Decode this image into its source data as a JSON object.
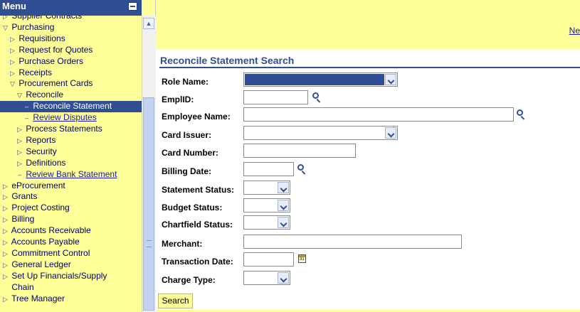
{
  "sidebar": {
    "title": "Menu",
    "items": [
      {
        "label": "Supplier Contracts",
        "indent": 0,
        "glyph": "▷",
        "state": "normal"
      },
      {
        "label": "Purchasing",
        "indent": 0,
        "glyph": "▽",
        "state": "normal"
      },
      {
        "label": "Requisitions",
        "indent": 1,
        "glyph": "▷",
        "state": "normal"
      },
      {
        "label": "Request for Quotes",
        "indent": 1,
        "glyph": "▷",
        "state": "normal"
      },
      {
        "label": "Purchase Orders",
        "indent": 1,
        "glyph": "▷",
        "state": "normal"
      },
      {
        "label": "Receipts",
        "indent": 1,
        "glyph": "▷",
        "state": "normal"
      },
      {
        "label": "Procurement Cards",
        "indent": 1,
        "glyph": "▽",
        "state": "normal"
      },
      {
        "label": "Reconcile",
        "indent": 2,
        "glyph": "▽",
        "state": "normal"
      },
      {
        "label": "Reconcile Statement",
        "indent": 3,
        "glyph": "–",
        "state": "selected"
      },
      {
        "label": "Review Disputes",
        "indent": 3,
        "glyph": "–",
        "state": "link"
      },
      {
        "label": "Process Statements",
        "indent": 2,
        "glyph": "▷",
        "state": "normal"
      },
      {
        "label": "Reports",
        "indent": 2,
        "glyph": "▷",
        "state": "normal"
      },
      {
        "label": "Security",
        "indent": 2,
        "glyph": "▷",
        "state": "normal"
      },
      {
        "label": "Definitions",
        "indent": 2,
        "glyph": "▷",
        "state": "normal"
      },
      {
        "label": "Review Bank Statement",
        "indent": 2,
        "glyph": "–",
        "state": "link"
      },
      {
        "label": "eProcurement",
        "indent": 0,
        "glyph": "▷",
        "state": "normal"
      },
      {
        "label": "Grants",
        "indent": 0,
        "glyph": "▷",
        "state": "normal"
      },
      {
        "label": "Project Costing",
        "indent": 0,
        "glyph": "▷",
        "state": "normal"
      },
      {
        "label": "Billing",
        "indent": 0,
        "glyph": "▷",
        "state": "normal"
      },
      {
        "label": "Accounts Receivable",
        "indent": 0,
        "glyph": "▷",
        "state": "normal"
      },
      {
        "label": "Accounts Payable",
        "indent": 0,
        "glyph": "▷",
        "state": "normal"
      },
      {
        "label": "Commitment Control",
        "indent": 0,
        "glyph": "▷",
        "state": "normal"
      },
      {
        "label": "General Ledger",
        "indent": 0,
        "glyph": "▷",
        "state": "normal"
      },
      {
        "label": "Set Up Financials/Supply",
        "indent": 0,
        "glyph": "▷",
        "state": "normal"
      },
      {
        "label": "Chain",
        "indent": 0,
        "glyph": "",
        "state": "normal"
      },
      {
        "label": "Tree Manager",
        "indent": 0,
        "glyph": "▷",
        "state": "normal"
      }
    ]
  },
  "topbar": {
    "new_window_link": "Ne"
  },
  "main": {
    "title": "Reconcile Statement Search",
    "search_button": "Search",
    "fields": {
      "role_name": {
        "label": "Role Name:",
        "value": "",
        "type": "select",
        "selected_highlight": true
      },
      "emplid": {
        "label": "EmplID:",
        "value": "",
        "type": "lookup"
      },
      "employee_name": {
        "label": "Employee Name:",
        "value": "",
        "type": "lookup"
      },
      "card_issuer": {
        "label": "Card Issuer:",
        "value": "",
        "type": "select"
      },
      "card_number": {
        "label": "Card Number:",
        "value": "",
        "type": "text"
      },
      "billing_date": {
        "label": "Billing Date:",
        "value": "",
        "type": "lookup"
      },
      "statement_status": {
        "label": "Statement Status:",
        "value": "",
        "type": "select"
      },
      "budget_status": {
        "label": "Budget Status:",
        "value": "",
        "type": "select"
      },
      "chartfield_status": {
        "label": "Chartfield Status:",
        "value": "",
        "type": "select"
      },
      "merchant": {
        "label": "Merchant:",
        "value": "",
        "type": "text"
      },
      "transaction_date": {
        "label": "Transaction Date:",
        "value": "",
        "type": "calendar",
        "calendar_day": "31"
      },
      "charge_type": {
        "label": "Charge Type:",
        "value": "",
        "type": "select"
      }
    }
  },
  "icons": {
    "lookup": "magnifier-icon",
    "calendar": "calendar-icon",
    "dropdown": "chevron-down-icon",
    "tree_expand": "triangle-right-icon",
    "tree_collapse": "triangle-down-icon"
  },
  "colors": {
    "accent": "#304e94",
    "panel_background": "#ffff99",
    "link": "#1a1aa8"
  }
}
